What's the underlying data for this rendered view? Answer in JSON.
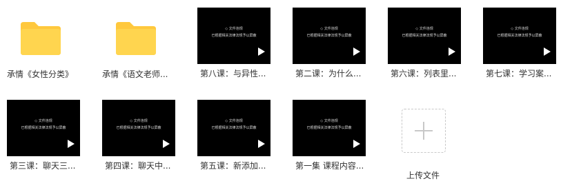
{
  "items": [
    {
      "type": "folder",
      "name": "承情《女性分类》"
    },
    {
      "type": "folder",
      "name": "承情《语文老师..."
    },
    {
      "type": "video",
      "name": "第八课：与异性...",
      "thumb_line1": "◇ 文件违规",
      "thumb_line2": "已根据相关法律法规予以屏蔽"
    },
    {
      "type": "video",
      "name": "第二课：为什么...",
      "thumb_line1": "◇ 文件违规",
      "thumb_line2": "已根据相关法律法规予以屏蔽"
    },
    {
      "type": "video",
      "name": "第六课：列表里...",
      "thumb_line1": "◇ 文件违规",
      "thumb_line2": "已根据相关法律法规予以屏蔽"
    },
    {
      "type": "video",
      "name": "第七课：学习案...",
      "thumb_line1": "◇ 文件违规",
      "thumb_line2": "已根据相关法律法规予以屏蔽"
    },
    {
      "type": "video",
      "name": "第三课：聊天三...",
      "thumb_line1": "◇ 文件违规",
      "thumb_line2": "已根据相关法律法规予以屏蔽"
    },
    {
      "type": "video",
      "name": "第四课：聊天中...",
      "thumb_line1": "◇ 文件违规",
      "thumb_line2": "已根据相关法律法规予以屏蔽"
    },
    {
      "type": "video",
      "name": "第五课：新添加...",
      "thumb_line1": "◇ 文件违规",
      "thumb_line2": "已根据相关法律法规予以屏蔽"
    },
    {
      "type": "video",
      "name": "第一集 课程内容...",
      "thumb_line1": "◇ 文件违规",
      "thumb_line2": "已根据相关法律法规予以屏蔽"
    }
  ],
  "upload": {
    "label": "上传文件",
    "icon": "plus-icon"
  },
  "colors": {
    "folder": "#FFD54F",
    "folder_tab": "#FFC83D",
    "thumb_bg": "#000000",
    "text": "#333333"
  }
}
